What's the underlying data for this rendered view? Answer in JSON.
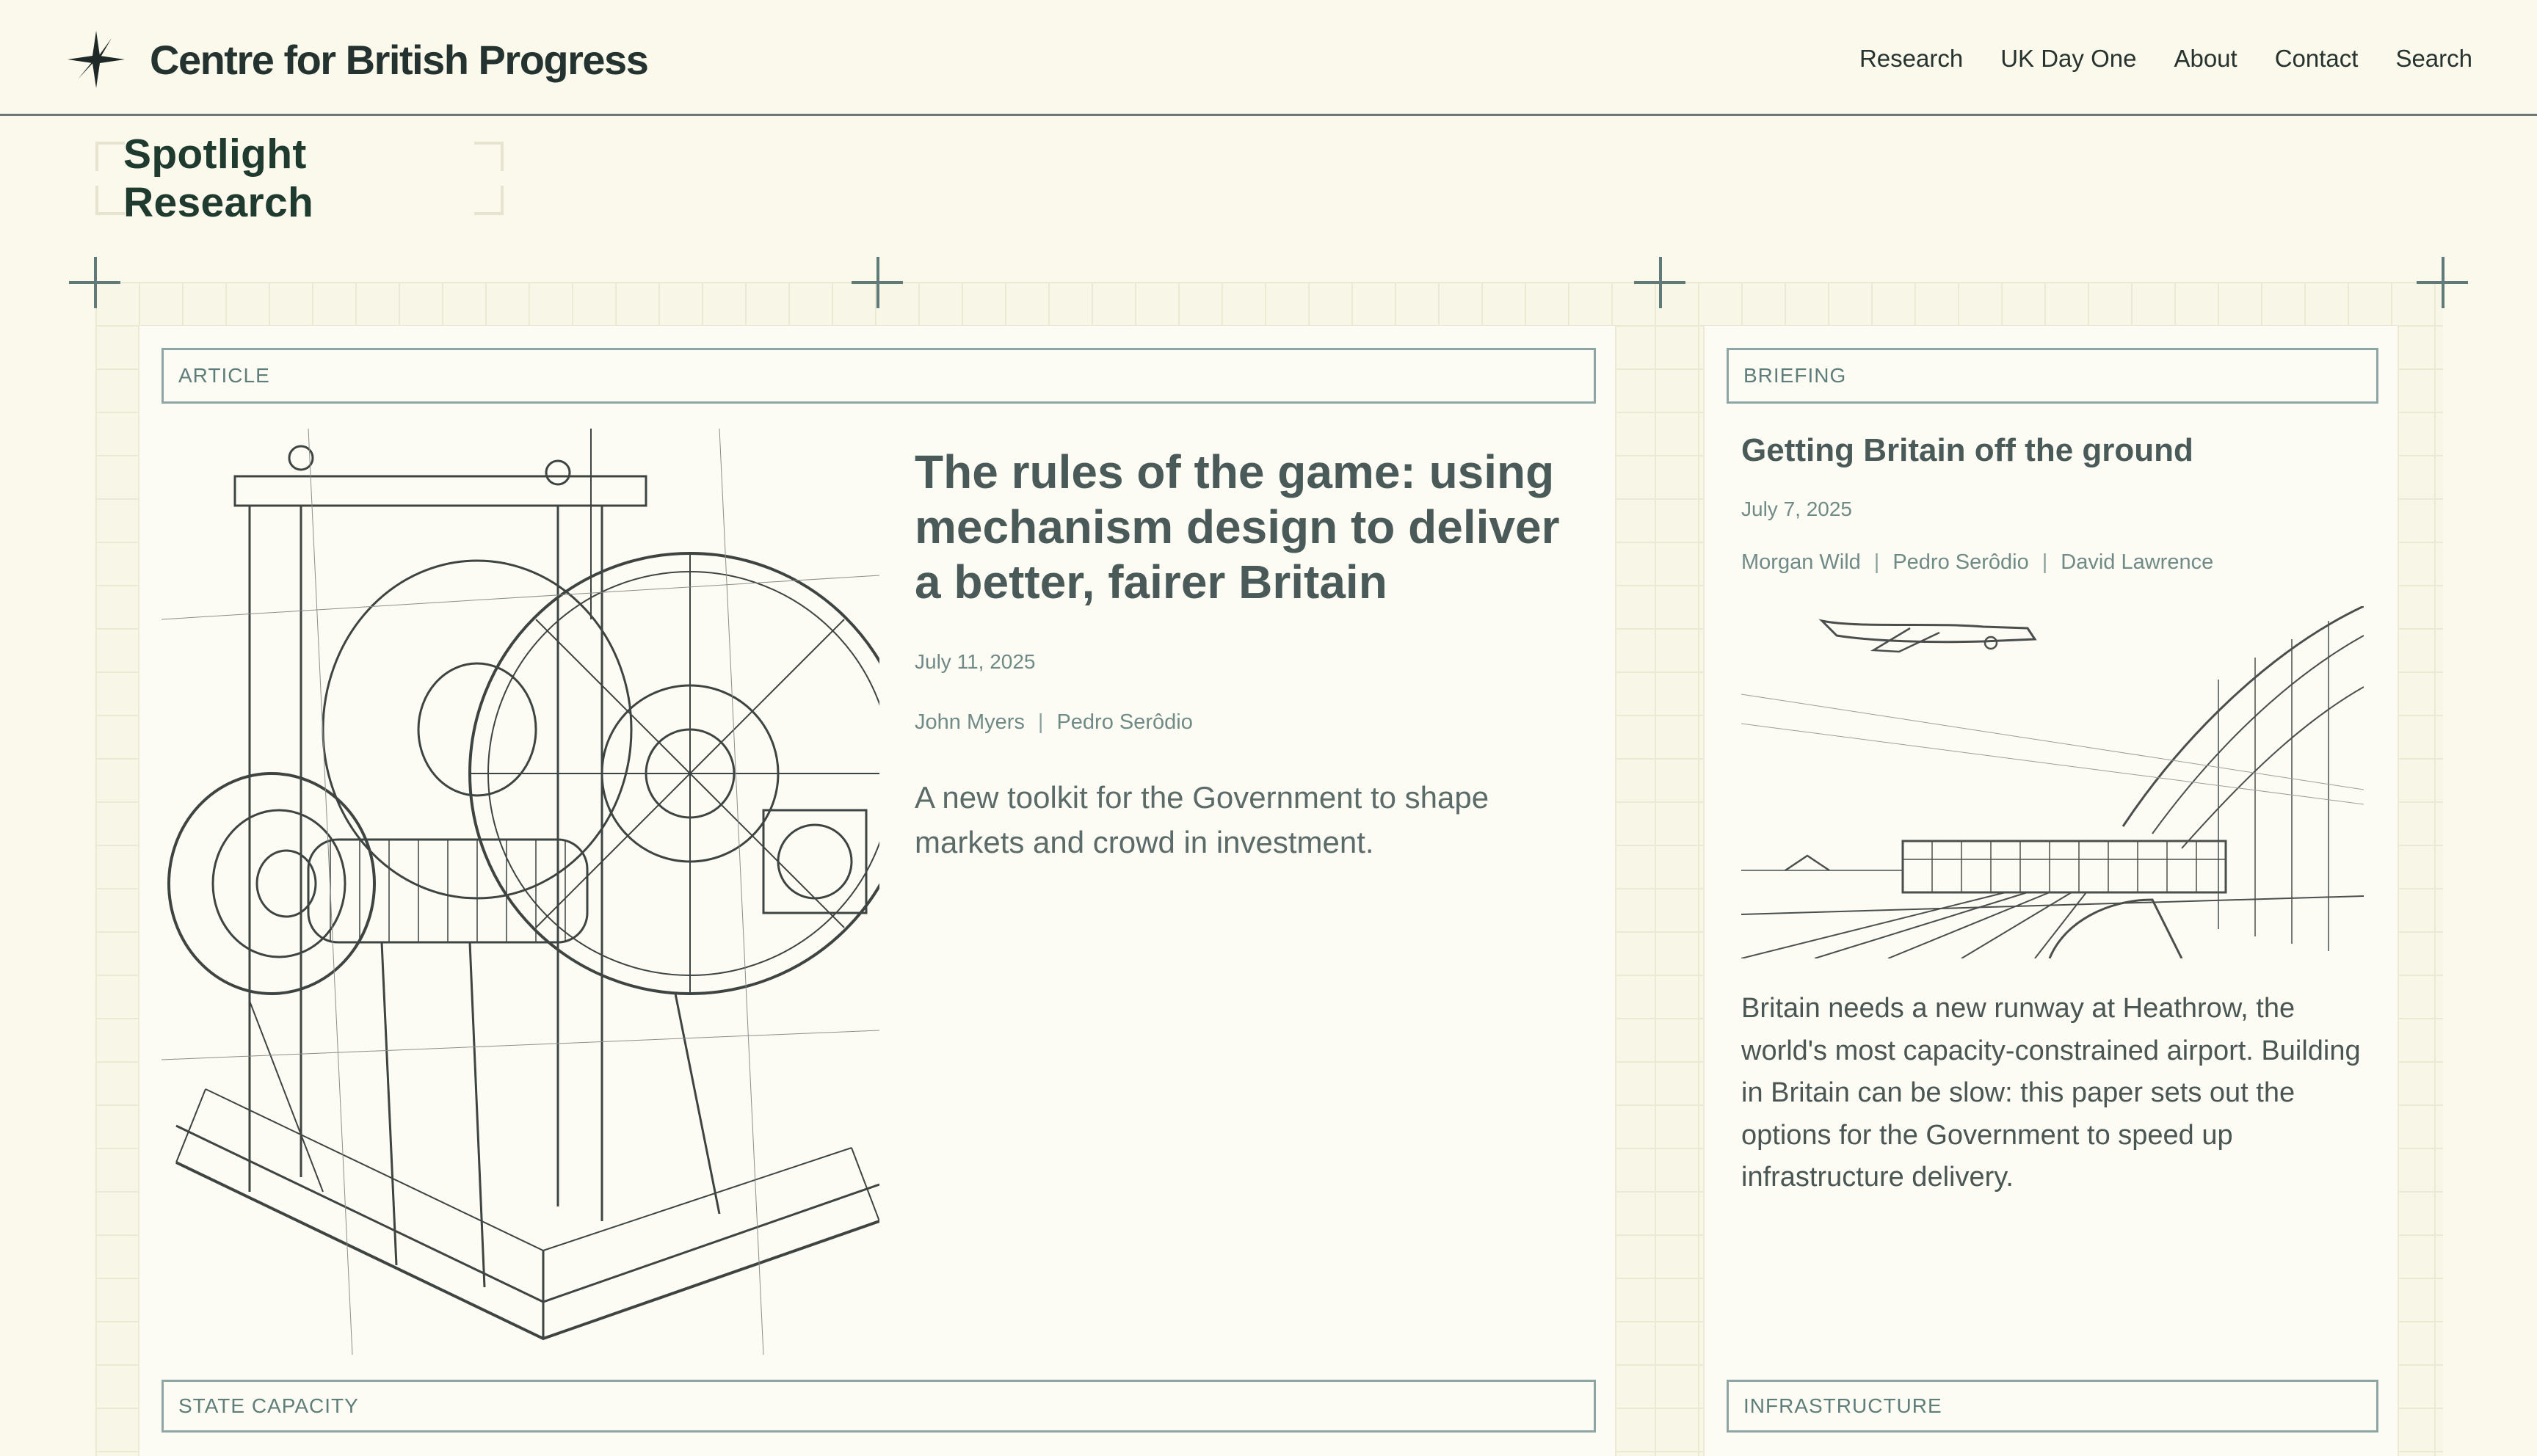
{
  "site": {
    "name": "Centre for British Progress",
    "logo_icon": "compass-star-icon"
  },
  "nav": {
    "items": [
      {
        "label": "Research"
      },
      {
        "label": "UK Day One"
      },
      {
        "label": "About"
      },
      {
        "label": "Contact"
      },
      {
        "label": "Search"
      }
    ]
  },
  "section": {
    "title": "Spotlight Research"
  },
  "cards": [
    {
      "type": "ARTICLE",
      "title": "The rules of the game: using mechanism design to deliver a better, fairer Britain",
      "date": "July 11, 2025",
      "authors": [
        "John Myers",
        "Pedro Serôdio"
      ],
      "author_separator": "|",
      "summary": "A new toolkit for the Government to shape markets and crowd in investment.",
      "topic": "STATE CAPACITY",
      "illustration": "machinery-sketch-illustration"
    },
    {
      "type": "BRIEFING",
      "title": "Getting Britain off the ground",
      "date": "July 7, 2025",
      "authors": [
        "Morgan Wild",
        "Pedro Serôdio",
        "David Lawrence"
      ],
      "author_separator": "|",
      "summary": "Britain needs a new runway at Heathrow, the world's most capacity-constrained airport. Building in Britain can be slow: this paper sets out the options for the Government to speed up infrastructure delivery.",
      "topic": "INFRASTRUCTURE",
      "illustration": "airport-terminal-sketch-illustration"
    }
  ],
  "colors": {
    "background": "#fbf9ec",
    "card": "#fdfcf4",
    "accent": "#5f7e7b",
    "heading": "#1f3a2f"
  }
}
